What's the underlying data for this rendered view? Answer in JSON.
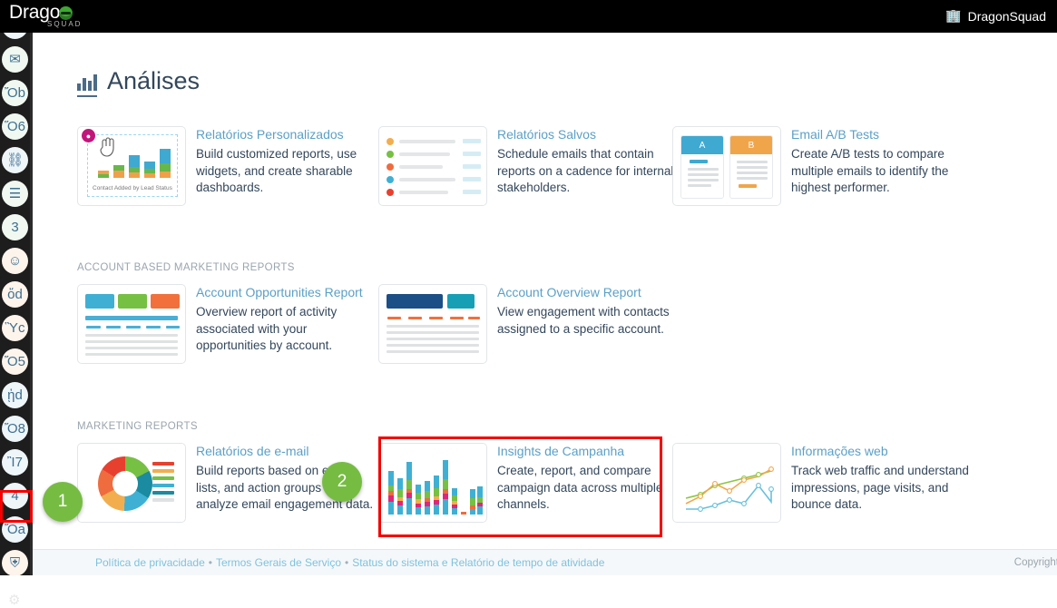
{
  "topbar": {
    "brand": "Dragon",
    "brand_sub": "SQUAD",
    "account": "DragonSquad",
    "account_icon": "building-icon"
  },
  "page": {
    "title": "Análises",
    "title_icon": "bar-chart-icon"
  },
  "sidebar": {
    "items": [
      {
        "name": "inbox-icon",
        "glyph": "⬒",
        "tone": "cool"
      },
      {
        "name": "email-open-icon",
        "glyph": "✉",
        "tone": "mint"
      },
      {
        "name": "clipboard-icon",
        "glyph": "Ὄb",
        "tone": "mint"
      },
      {
        "name": "book-icon",
        "glyph": "Ὅ6",
        "tone": "mint"
      },
      {
        "name": "workflow-icon",
        "glyph": "⛓",
        "tone": "cool"
      },
      {
        "name": "list-icon",
        "glyph": "☰",
        "tone": "mint"
      },
      {
        "name": "megaphone-icon",
        "glyph": "὎3",
        "tone": "mint"
      },
      {
        "name": "chat-smile-icon",
        "glyph": "☺",
        "tone": "warm"
      },
      {
        "name": "thumbs-up-icon",
        "glyph": "ὄd",
        "tone": "warm"
      },
      {
        "name": "media-icon",
        "glyph": "Ὓc",
        "tone": "warm"
      },
      {
        "name": "calendar-icon",
        "glyph": "Ὄ5",
        "tone": "warm"
      },
      {
        "name": "handshake-icon",
        "glyph": "ᾑd",
        "tone": "cool"
      },
      {
        "name": "trend-chart-icon",
        "glyph": "Ὄ8",
        "tone": "cool"
      },
      {
        "name": "headset-icon",
        "glyph": "Ἲ7",
        "tone": "cool"
      },
      {
        "name": "add-user-icon",
        "glyph": "὆4",
        "tone": "cool"
      },
      {
        "name": "analytics-icon",
        "glyph": "Ὄa",
        "tone": "cool"
      },
      {
        "name": "shield-bolt-icon",
        "glyph": "⛨",
        "tone": "warm"
      }
    ],
    "settings_icon": "gear-icon",
    "drag_handle": "drag-handle-dots"
  },
  "sections": [
    {
      "label": "",
      "cards": [
        {
          "title": "Relatórios Personalizados",
          "desc": "Build customized reports, use widgets, and create sharable dashboards.",
          "thumb": "custom-report-builder-thumbnail",
          "thumb_caption": "Contact Added by Lead Status",
          "thumb_badge": "☺"
        },
        {
          "title": "Relatórios Salvos",
          "desc": "Schedule emails that contain reports on a cadence for internal stakeholders.",
          "thumb": "saved-reports-list-thumbnail"
        },
        {
          "title": "Email A/B Tests",
          "desc": "Create A/B tests to compare multiple emails to identify the highest performer.",
          "thumb": "ab-test-thumbnail",
          "variant_a": "A",
          "variant_b": "B"
        }
      ]
    },
    {
      "label": "ACCOUNT BASED MARKETING REPORTS",
      "cards": [
        {
          "title": "Account Opportunities Report",
          "desc": "Overview report of activity associated with your opportunities by account.",
          "thumb": "account-opportunities-thumbnail"
        },
        {
          "title": "Account Overview Report",
          "desc": "View engagement with contacts assigned to a specific account.",
          "thumb": "account-overview-thumbnail"
        }
      ]
    },
    {
      "label": "MARKETING REPORTS",
      "cards": [
        {
          "title": "Relatórios de e-mail",
          "desc": "Build reports based on emails, lists, and action groups to analyze email engagement data.",
          "thumb": "email-donut-thumbnail"
        },
        {
          "title": "Insights de Campanha",
          "desc": "Create, report, and compare campaign data across multiple channels.",
          "thumb": "campaign-stacked-bars-thumbnail"
        },
        {
          "title": "Informações web",
          "desc": "Track web traffic and understand impressions, page visits, and bounce data.",
          "thumb": "web-line-chart-thumbnail"
        }
      ]
    }
  ],
  "annotations": {
    "badge_one": "1",
    "badge_two": "2",
    "highlight_color": "#f40000",
    "badge_color": "#76bc43"
  },
  "footer": {
    "link_privacy": "Política de privacidade",
    "link_terms": "Termos Gerais de Serviço",
    "link_status": "Status do sistema e Relatório de tempo de atividade",
    "separator": "•",
    "copyright": "Copyright"
  }
}
